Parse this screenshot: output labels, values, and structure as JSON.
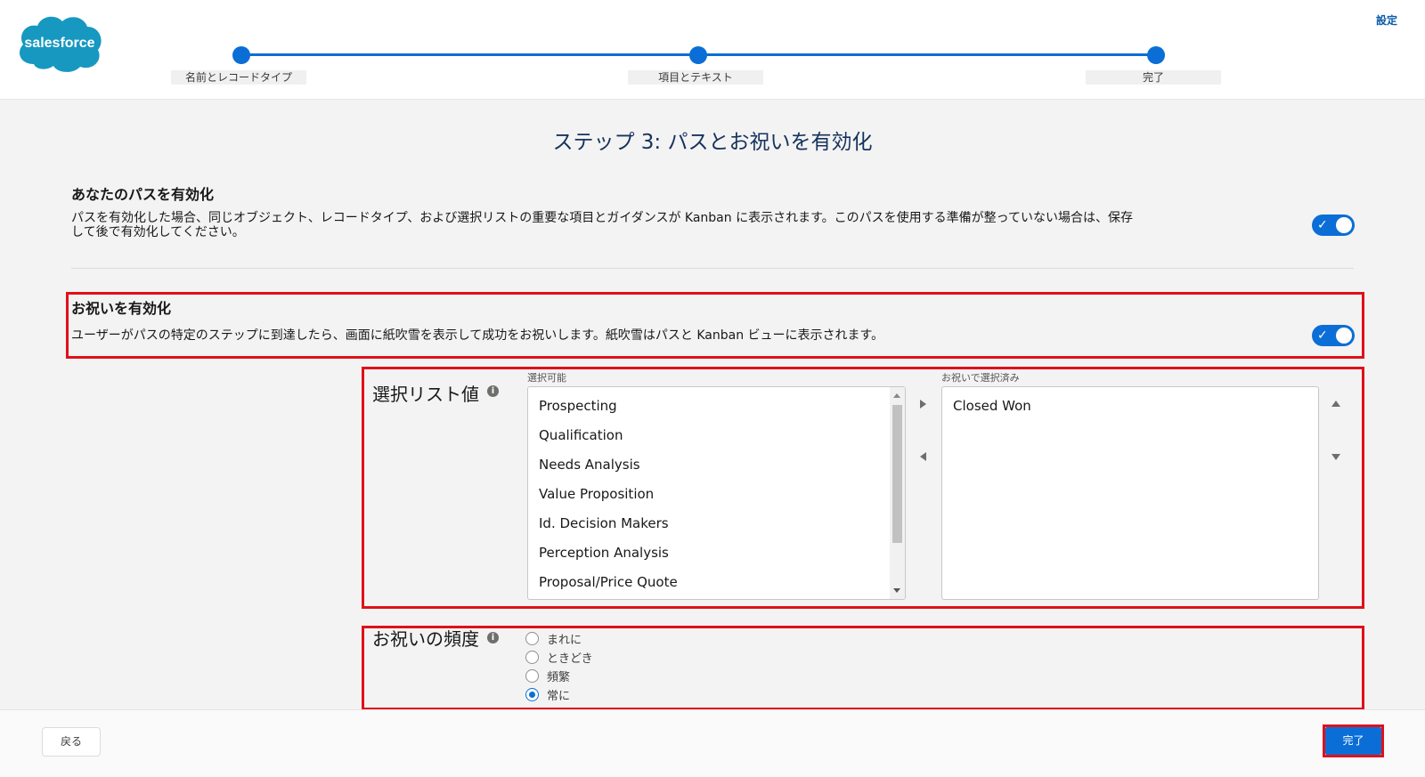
{
  "header": {
    "logo_text": "salesforce",
    "settings_label": "設定",
    "steps": [
      {
        "label": "名前とレコードタイプ"
      },
      {
        "label": "項目とテキスト"
      },
      {
        "label": "完了"
      }
    ]
  },
  "main": {
    "title": "ステップ 3: パスとお祝いを有効化",
    "enable_path": {
      "title": "あなたのパスを有効化",
      "description_line1": "パスを有効化した場合、同じオブジェクト、レコードタイプ、および選択リストの重要な項目とガイダンスが Kanban に表示されます。このパスを使用する準備が整っていない場合は、保存",
      "description_line2": "して後で有効化してください。",
      "enabled": true
    },
    "enable_celebration": {
      "title": "お祝いを有効化",
      "description": "ユーザーがパスの特定のステップに到達したら、画面に紙吹雪を表示して成功をお祝いします。紙吹雪はパスと Kanban ビューに表示されます。",
      "enabled": true
    },
    "picklist": {
      "label": "選択リスト値",
      "available_label": "選択可能",
      "selected_label": "お祝いで選択済み",
      "available": [
        "Prospecting",
        "Qualification",
        "Needs Analysis",
        "Value Proposition",
        "Id. Decision Makers",
        "Perception Analysis",
        "Proposal/Price Quote"
      ],
      "selected": [
        "Closed Won"
      ]
    },
    "frequency": {
      "label": "お祝いの頻度",
      "options": [
        "まれに",
        "ときどき",
        "頻繁",
        "常に"
      ],
      "selected": "常に"
    }
  },
  "footer": {
    "back_label": "戻る",
    "done_label": "完了"
  },
  "colors": {
    "accent": "#0b6ed6",
    "highlight": "#e0101a",
    "title": "#16325c"
  }
}
